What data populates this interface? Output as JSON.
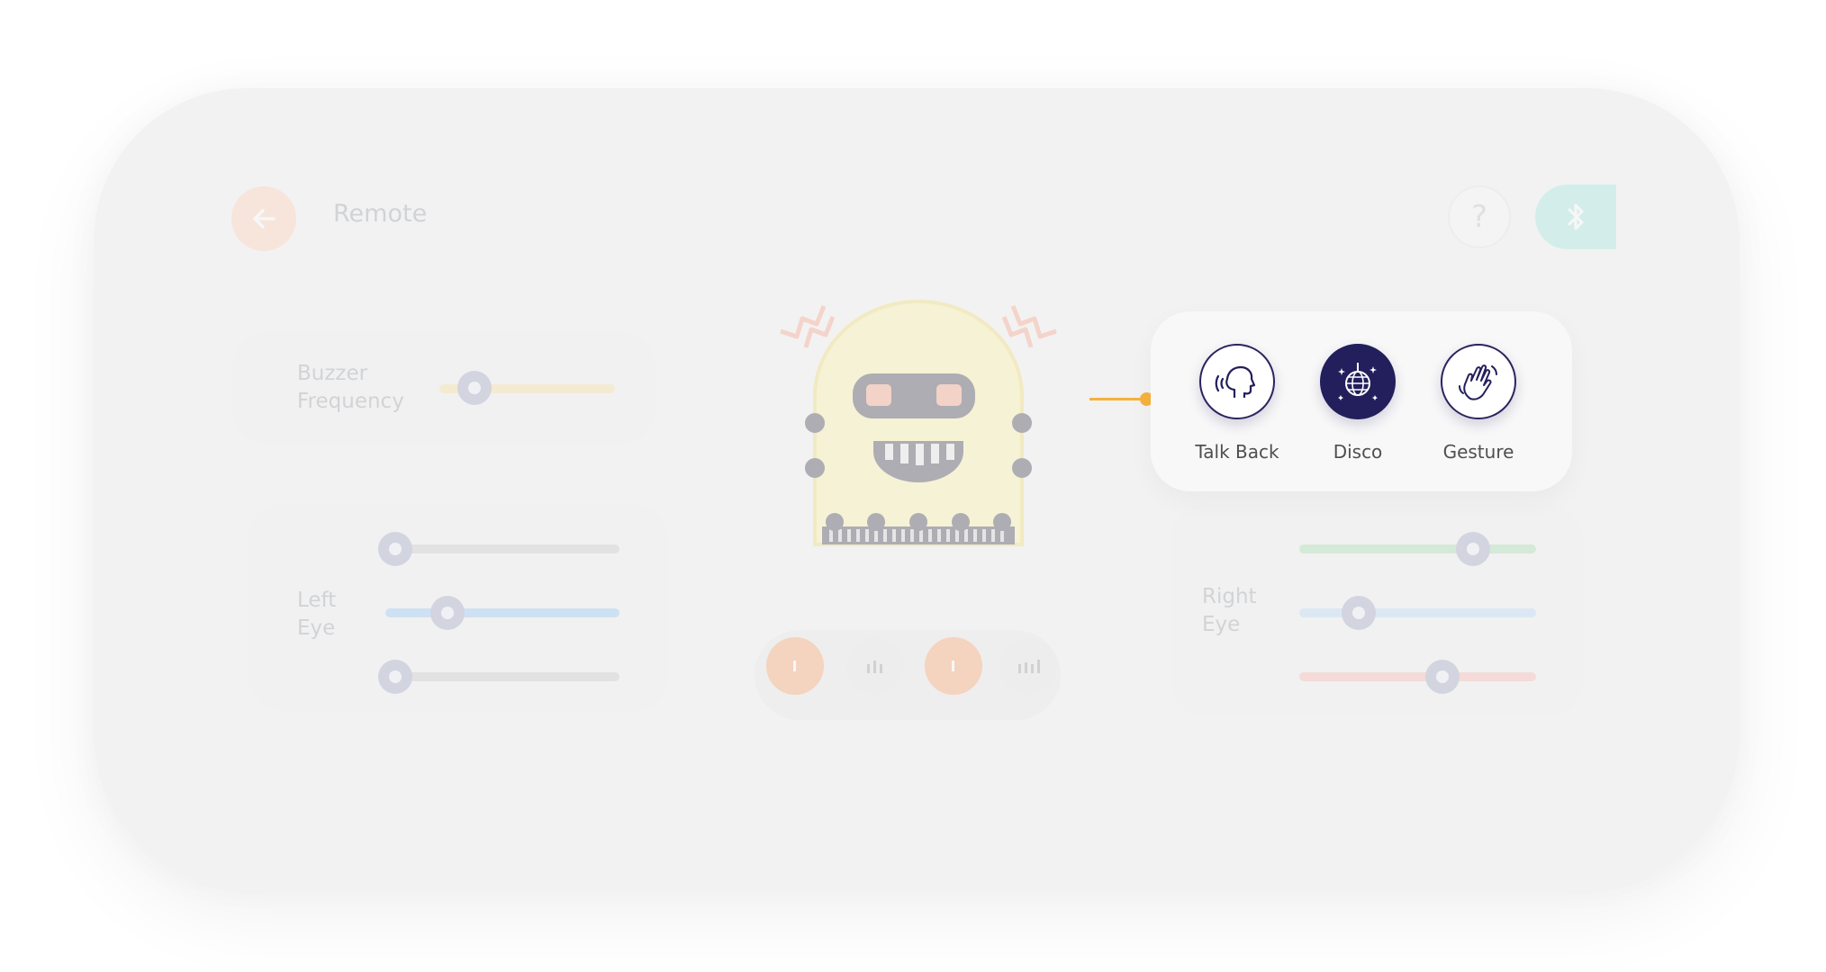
{
  "header": {
    "title": "Remote",
    "help_label": "?"
  },
  "buzzer": {
    "label_line1": "Buzzer",
    "label_line2": "Frequency",
    "value": 0.2
  },
  "left_eye": {
    "label_line1": "Left",
    "label_line2": "Eye",
    "red": 0.0,
    "green": 0.0,
    "blue": 0.28
  },
  "right_eye": {
    "label_line1": "Right",
    "label_line2": "Eye",
    "green": 0.75,
    "blue": 0.25,
    "red": 0.6
  },
  "modes": {
    "items": [
      {
        "label": "Talk Back",
        "icon": "talking-head-icon",
        "active": false
      },
      {
        "label": "Disco",
        "icon": "disco-ball-icon",
        "active": true
      },
      {
        "label": "Gesture",
        "icon": "waving-hand-icon",
        "active": false
      }
    ]
  },
  "colors": {
    "accent": "#f6b23c",
    "active_mode": "#231f5c",
    "back_button": "#ffcfb8",
    "bluetooth_button": "#9fe6dc"
  }
}
